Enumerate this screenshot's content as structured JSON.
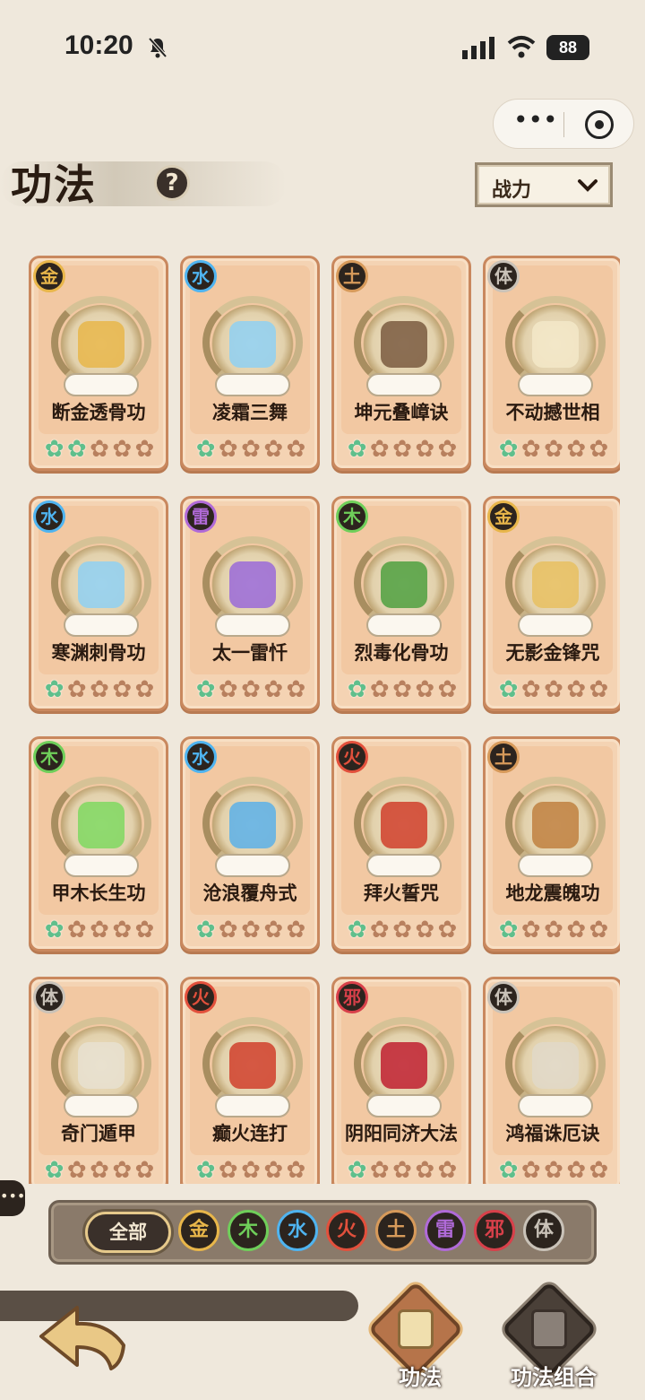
{
  "status_bar": {
    "time": "10:20",
    "battery": "88"
  },
  "header": {
    "title": "功法",
    "help_label": "?",
    "sort_label": "战力"
  },
  "cards": [
    {
      "element": "金",
      "name": "断金透骨功",
      "stars_on": 2
    },
    {
      "element": "水",
      "name": "凌霜三舞",
      "stars_on": 1
    },
    {
      "element": "土",
      "name": "坤元叠嶂诀",
      "stars_on": 1
    },
    {
      "element": "体",
      "name": "不动撼世相",
      "stars_on": 1
    },
    {
      "element": "水",
      "name": "寒渊刺骨功",
      "stars_on": 1
    },
    {
      "element": "雷",
      "name": "太一雷忏",
      "stars_on": 1
    },
    {
      "element": "木",
      "name": "烈毒化骨功",
      "stars_on": 1
    },
    {
      "element": "金",
      "name": "无影金锋咒",
      "stars_on": 1
    },
    {
      "element": "木",
      "name": "甲木长生功",
      "stars_on": 1
    },
    {
      "element": "水",
      "name": "沧浪覆舟式",
      "stars_on": 1
    },
    {
      "element": "火",
      "name": "拜火誓咒",
      "stars_on": 1
    },
    {
      "element": "土",
      "name": "地龙震魄功",
      "stars_on": 1
    },
    {
      "element": "体",
      "name": "奇门遁甲",
      "stars_on": 1
    },
    {
      "element": "火",
      "name": "癫火连打",
      "stars_on": 1
    },
    {
      "element": "邪",
      "name": "阴阳同济大法",
      "stars_on": 1
    },
    {
      "element": "体",
      "name": "鸿福诛厄诀",
      "stars_on": 1
    }
  ],
  "filter": {
    "all_label": "全部",
    "chips": [
      "金",
      "木",
      "水",
      "火",
      "土",
      "雷",
      "邪",
      "体"
    ]
  },
  "element_colors": {
    "金": "#e8b64a",
    "木": "#6fcf5a",
    "水": "#4fb4f0",
    "火": "#e2503c",
    "土": "#d79a5a",
    "雷": "#b06ad8",
    "邪": "#d8404a",
    "体": "#c9c2b8"
  },
  "nav": {
    "tab_active": "功法",
    "tab_combo": "功法组合"
  }
}
